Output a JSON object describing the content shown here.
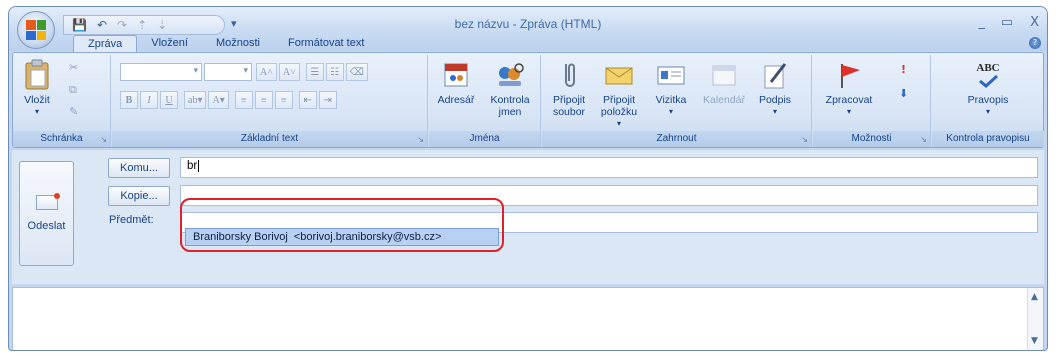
{
  "window": {
    "title": "bez názvu - Zpráva (HTML)",
    "minimize": "_",
    "maximize": "▭",
    "close": "X"
  },
  "qat": {
    "more": "▾"
  },
  "tabs": [
    {
      "label": "Zpráva",
      "active": true
    },
    {
      "label": "Vložení",
      "active": false
    },
    {
      "label": "Možnosti",
      "active": false
    },
    {
      "label": "Formátovat text",
      "active": false
    }
  ],
  "ribbon": {
    "groups": {
      "clipboard": {
        "label": "Schránka",
        "paste": "Vložit"
      },
      "basic_text": {
        "label": "Základní text"
      },
      "names": {
        "label": "Jména",
        "address_book": "Adresář",
        "check_names": "Kontrola jmen"
      },
      "include": {
        "label": "Zahrnout",
        "attach_file": "Připojit soubor",
        "attach_item": "Připojit položku",
        "business_card": "Vizitka",
        "calendar": "Kalendář",
        "signature": "Podpis"
      },
      "options": {
        "label": "Možnosti",
        "follow_up": "Zpracovat"
      },
      "proofing": {
        "label": "Kontrola pravopisu",
        "spelling": "Pravopis",
        "abc": "ABC"
      }
    }
  },
  "header": {
    "send": "Odeslat",
    "to_button": "Komu...",
    "cc_button": "Kopie...",
    "subject_label": "Předmět:",
    "to_value": "br",
    "cc_value": "",
    "subject_value": ""
  },
  "autocomplete": {
    "suggestion": "Braniborsky Borivoj  <borivoj.braniborsky@vsb.cz>"
  },
  "colors": {
    "accent": "#15428b",
    "highlight_ring": "#e0202a",
    "ribbon_bg": "#dfe9f7"
  }
}
